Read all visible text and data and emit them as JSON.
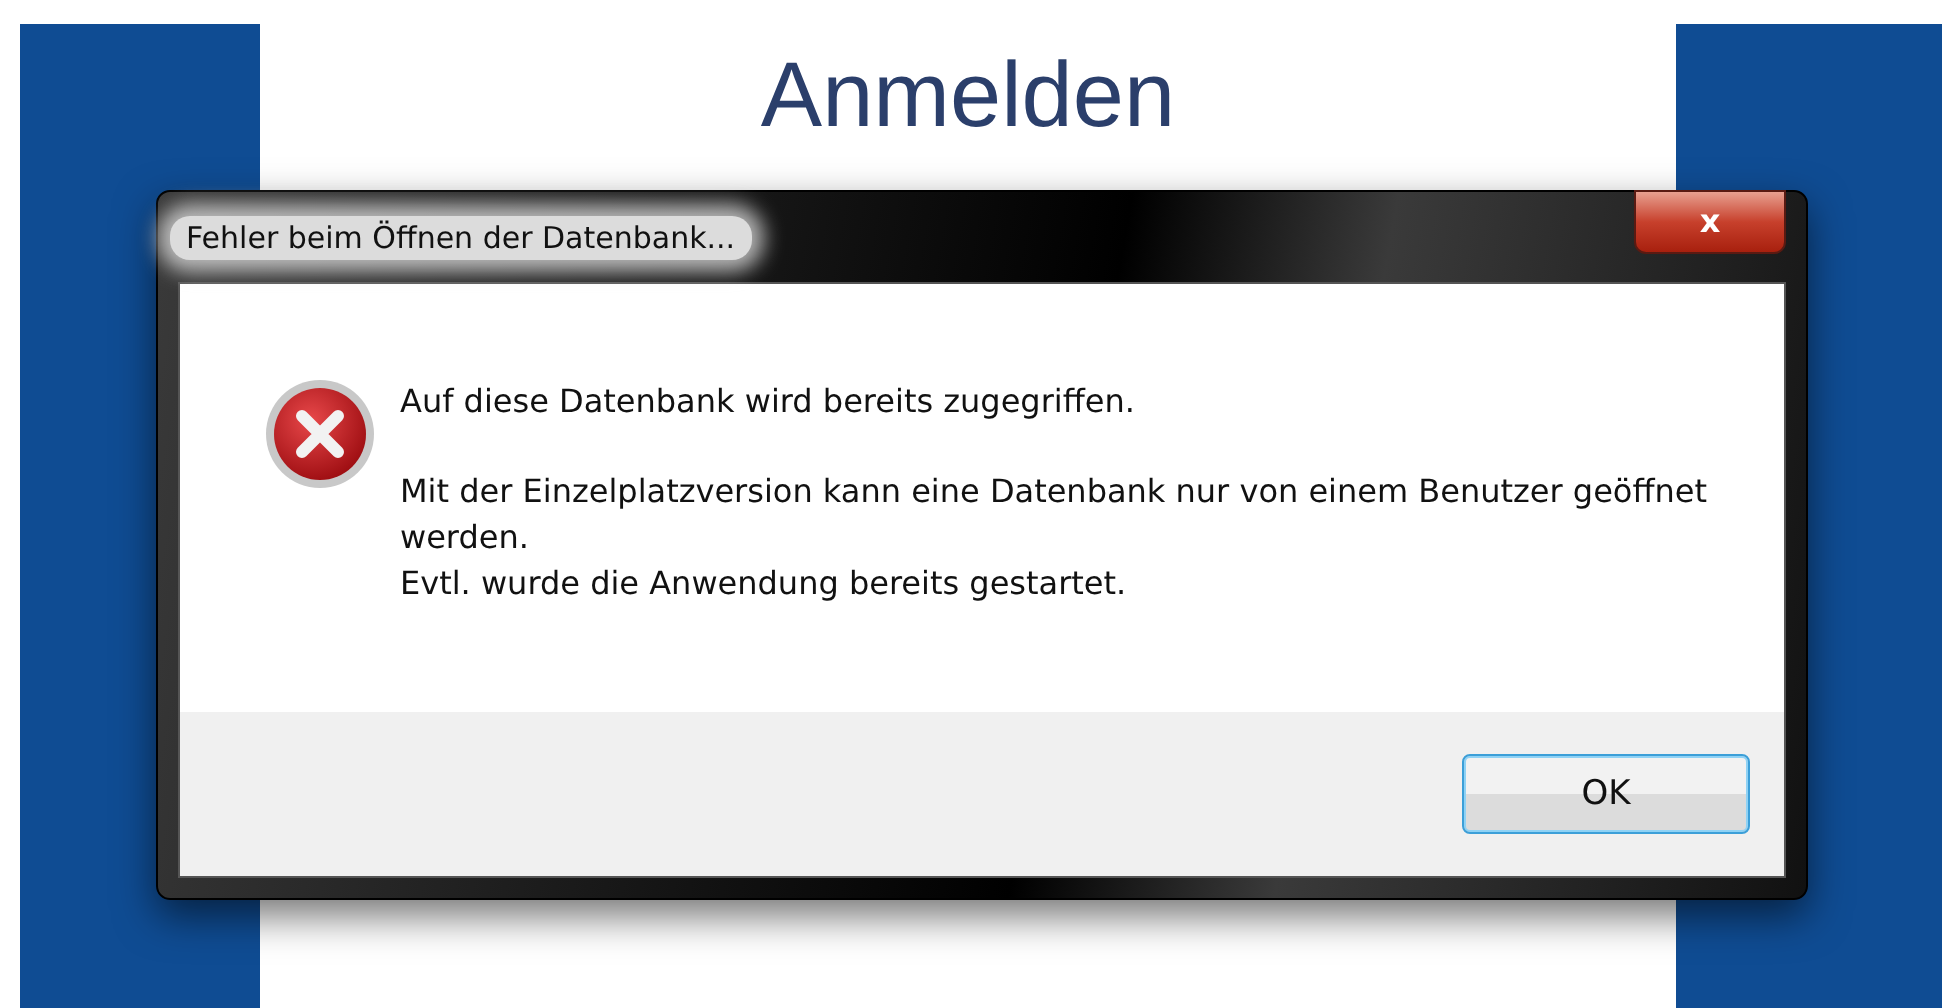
{
  "page": {
    "heading": "Anmelden"
  },
  "dialog": {
    "title": "Fehler beim Öffnen der Datenbank...",
    "close_label": "x",
    "messages": [
      "Auf diese Datenbank wird bereits zugegriffen.",
      "Mit der Einzelplatzversion kann eine Datenbank nur von einem Benutzer geöffnet werden.\nEvtl. wurde die Anwendung bereits gestartet."
    ],
    "buttons": [
      {
        "label": "OK",
        "focused": true
      }
    ]
  }
}
